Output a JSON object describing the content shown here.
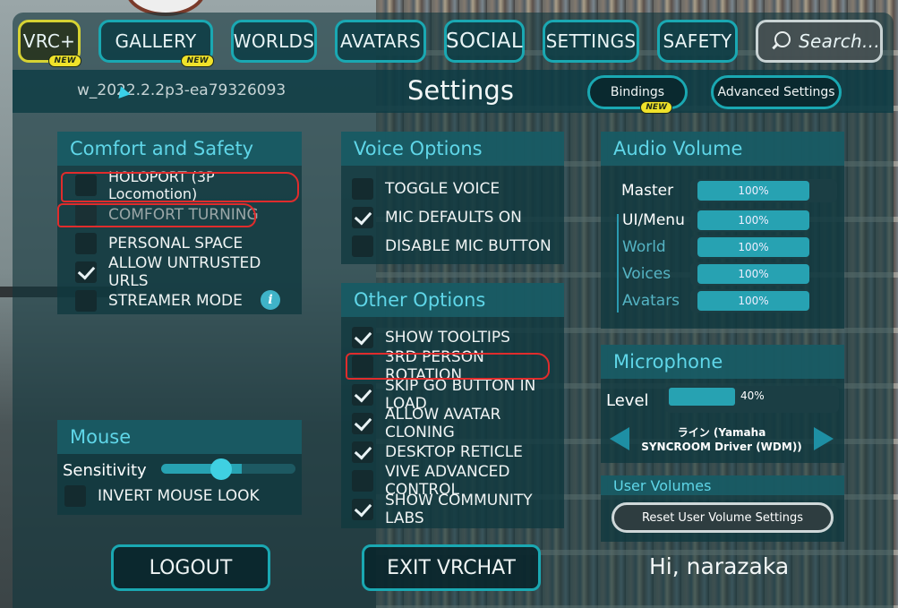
{
  "nav": {
    "vrc_plus": "VRC+",
    "gallery": "GALLERY",
    "worlds": "WORLDS",
    "avatars": "AVATARS",
    "social": "SOCIAL",
    "settings": "SETTINGS",
    "safety": "SAFETY",
    "search": "Search...",
    "new_badge": "NEW"
  },
  "header": {
    "version": "w_2022.2.2p3-ea79326093",
    "title": "Settings",
    "bindings": "Bindings",
    "advanced": "Advanced Settings"
  },
  "comfort": {
    "title": "Comfort and Safety",
    "items": [
      {
        "label": "HOLOPORT (3P Locomotion)",
        "checked": false
      },
      {
        "label": "COMFORT TURNING",
        "checked": false
      },
      {
        "label": "PERSONAL SPACE",
        "checked": false
      },
      {
        "label": "ALLOW UNTRUSTED URLS",
        "checked": true
      },
      {
        "label": "STREAMER MODE",
        "checked": false
      }
    ]
  },
  "voice": {
    "title": "Voice Options",
    "items": [
      {
        "label": "TOGGLE VOICE",
        "checked": false
      },
      {
        "label": "MIC DEFAULTS ON",
        "checked": true
      },
      {
        "label": "DISABLE MIC BUTTON",
        "checked": false
      }
    ]
  },
  "other": {
    "title": "Other Options",
    "items": [
      {
        "label": "SHOW TOOLTIPS",
        "checked": true
      },
      {
        "label": "3RD PERSON ROTATION",
        "checked": false
      },
      {
        "label": "SKIP GO BUTTON IN LOAD",
        "checked": true
      },
      {
        "label": "ALLOW AVATAR CLONING",
        "checked": true
      },
      {
        "label": "DESKTOP RETICLE",
        "checked": true
      },
      {
        "label": "VIVE ADVANCED CONTROL",
        "checked": false
      },
      {
        "label": "SHOW COMMUNITY LABS",
        "checked": true
      }
    ]
  },
  "audio": {
    "title": "Audio Volume",
    "channels": [
      {
        "label": "Master",
        "value": "100%"
      },
      {
        "label": "UI/Menu",
        "value": "100%"
      },
      {
        "label": "World",
        "value": "100%"
      },
      {
        "label": "Voices",
        "value": "100%"
      },
      {
        "label": "Avatars",
        "value": "100%"
      }
    ]
  },
  "microphone": {
    "title": "Microphone",
    "level_label": "Level",
    "level_value": "40%",
    "level_fraction": 0.4,
    "device_line1": "ライン (Yamaha",
    "device_line2": "SYNCROOM Driver (WDM))"
  },
  "user_volumes": {
    "title": "User Volumes",
    "reset": "Reset User Volume Settings"
  },
  "mouse": {
    "title": "Mouse",
    "sensitivity": "Sensitivity",
    "sensitivity_fraction": 0.45,
    "invert": "INVERT MOUSE LOOK",
    "invert_checked": false
  },
  "footer": {
    "logout": "LOGOUT",
    "exit": "EXIT VRCHAT",
    "greeting": "Hi, narazaka"
  },
  "colors": {
    "accent": "#1aa8b2",
    "heading": "#5fd6e8",
    "vrc_plus": "#d6d233",
    "annotation": "#e02c2c"
  }
}
